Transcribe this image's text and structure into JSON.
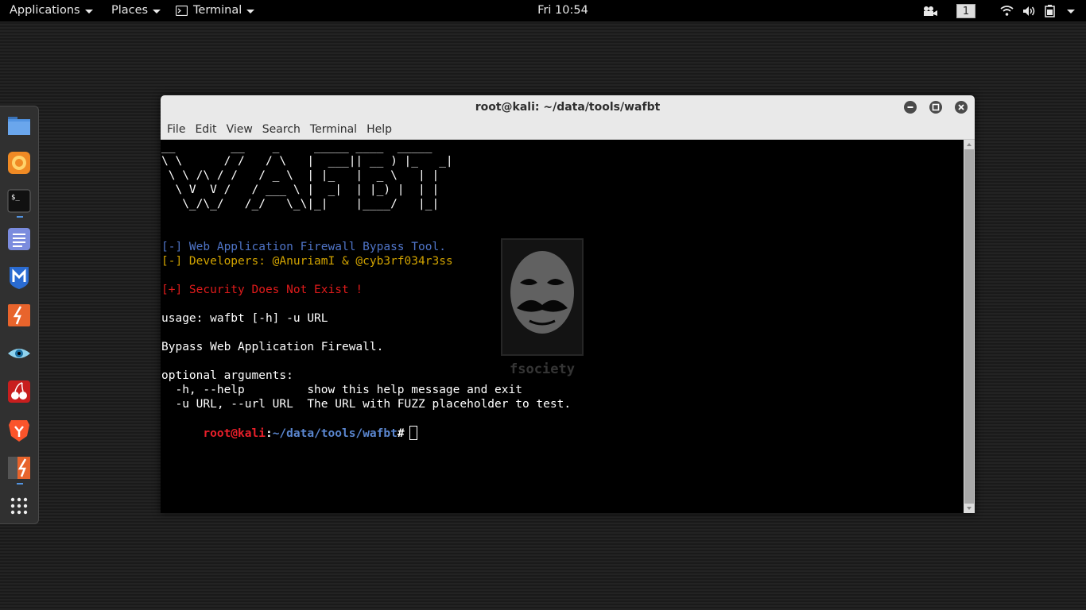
{
  "topbar": {
    "applications": "Applications",
    "places": "Places",
    "terminal": "Terminal",
    "clock": "Fri 10:54",
    "workspace": "1"
  },
  "dock": {
    "items": [
      {
        "icon": "files-icon"
      },
      {
        "icon": "firefox-icon"
      },
      {
        "icon": "terminal-icon"
      },
      {
        "icon": "text-editor-icon"
      },
      {
        "icon": "metasploit-icon"
      },
      {
        "icon": "burpsuite-icon"
      },
      {
        "icon": "eye-icon"
      },
      {
        "icon": "cherry-icon"
      },
      {
        "icon": "brave-icon"
      },
      {
        "icon": "burpsuite-alt-icon"
      },
      {
        "icon": "app-grid-icon"
      }
    ]
  },
  "window": {
    "title": "root@kali: ~/data/tools/wafbt",
    "menu": [
      "File",
      "Edit",
      "View",
      "Search",
      "Terminal",
      "Help"
    ]
  },
  "terminal": {
    "banner": "__        __    _     _____ ____  _____ \n\\ \\      / /   / \\   |  ___|| __ ) |_   _|\n \\ \\ /\\ / /   / _ \\  | |_   |  _ \\   | |  \n  \\ V  V /   / ___ \\ |  _|  | |_) |  | |  \n   \\_/\\_/   /_/   \\_\\|_|    |____/   |_|  ",
    "info_tool": "[-] Web Application Firewall Bypass Tool.",
    "info_dev": "[-] Developers: @AnuriamI & @cyb3rf034r3ss",
    "info_security": "[+] Security Does Not Exist !",
    "usage": "usage: wafbt [-h] -u URL",
    "description": "Bypass Web Application Firewall.",
    "optional_header": "optional arguments:",
    "arg_help": "  -h, --help         show this help message and exit",
    "arg_url": "  -u URL, --url URL  The URL with FUZZ placeholder to test.",
    "prompt_user": "root@kali",
    "prompt_sep": ":",
    "prompt_path": "~/data/tools/wafbt",
    "prompt_symbol": "#",
    "watermark": "fsociety"
  },
  "colors": {
    "blue": "#4f74c7",
    "yellow": "#d1a300",
    "red": "#e01b1b",
    "prompt_red": "#e81f2a",
    "prompt_blue": "#5a86cf"
  }
}
